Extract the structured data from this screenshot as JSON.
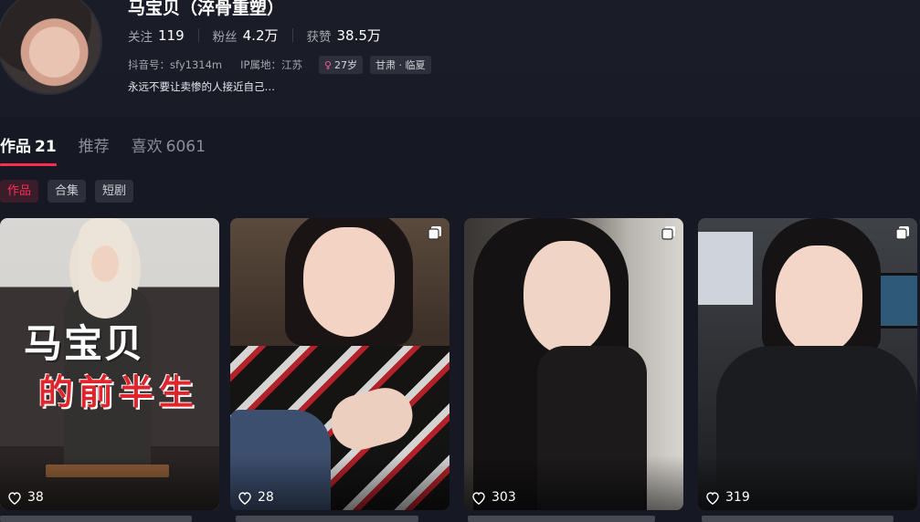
{
  "profile": {
    "name": "马宝贝（淬骨重塑）",
    "stats": [
      {
        "label": "关注",
        "value": "119"
      },
      {
        "label": "粉丝",
        "value": "4.2万"
      },
      {
        "label": "获赞",
        "value": "38.5万"
      }
    ],
    "douyin_id": "抖音号：sfy1314m",
    "ip_location": "IP属地：江苏",
    "age_tag": "27岁",
    "region_tag": "甘肃 · 临夏",
    "bio": "永远不要让卖惨的人接近自己…"
  },
  "tabs": [
    {
      "label": "作品",
      "count": "21"
    },
    {
      "label": "推荐",
      "count": ""
    },
    {
      "label": "喜欢",
      "count": "6061"
    }
  ],
  "filters": [
    "作品",
    "合集",
    "短剧"
  ],
  "cover_text": {
    "line1": "马宝贝",
    "line2": "的前半生"
  },
  "videos": [
    {
      "likes": "38",
      "multi_image": false
    },
    {
      "likes": "28",
      "multi_image": true
    },
    {
      "likes": "303",
      "multi_image": true
    },
    {
      "likes": "319",
      "multi_image": true
    }
  ],
  "colors": {
    "accent": "#fe2c55",
    "background": "#161823"
  }
}
